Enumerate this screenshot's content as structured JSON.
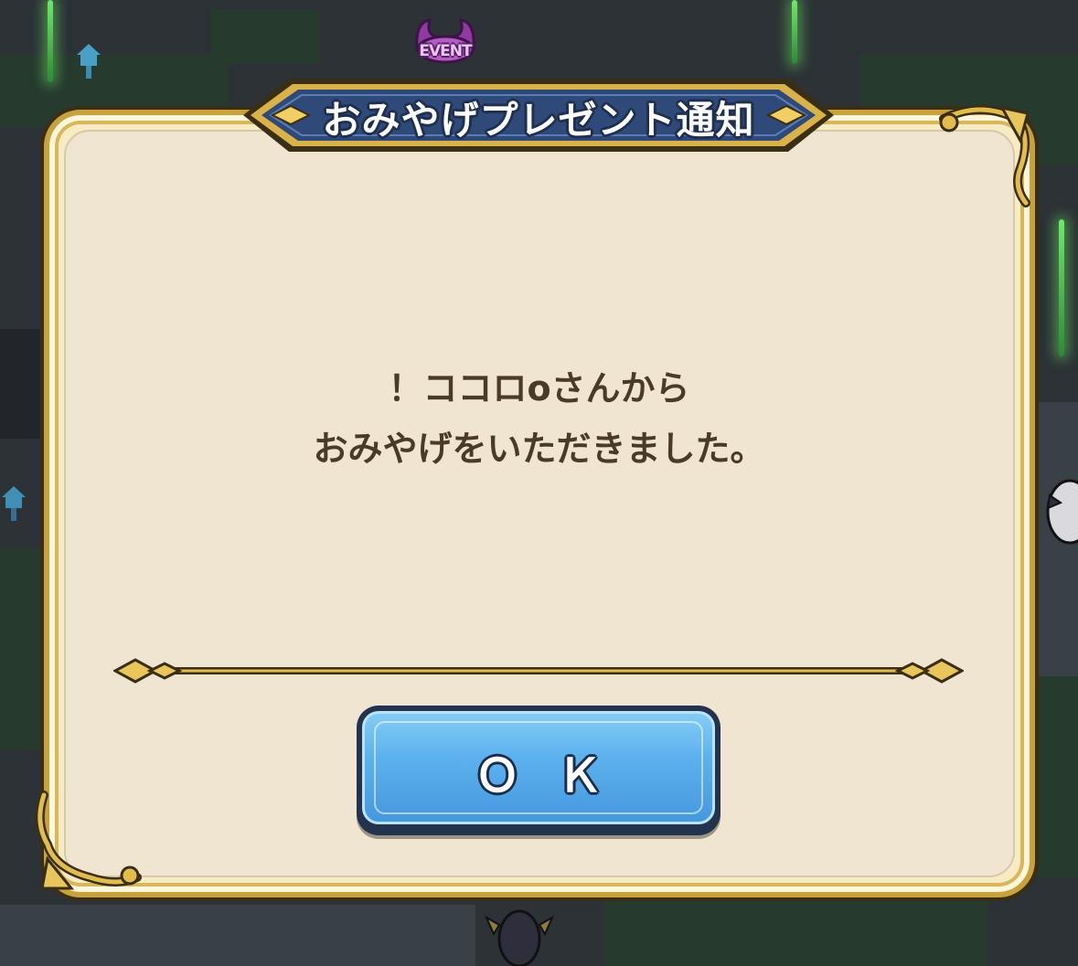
{
  "event_badge": {
    "label": "EVENT"
  },
  "dialog": {
    "title": "おみやげプレゼント通知",
    "message_lines": [
      "！ココロoさんから",
      "おみやげをいただきました。"
    ],
    "ok_label": "ＯＫ"
  },
  "colors": {
    "panel": "#efe5d1",
    "frame_gold": "#c8a23e",
    "title_plate": "#2f4a78",
    "button_blue": "#5cb2ee",
    "text": "#4a3b26"
  }
}
